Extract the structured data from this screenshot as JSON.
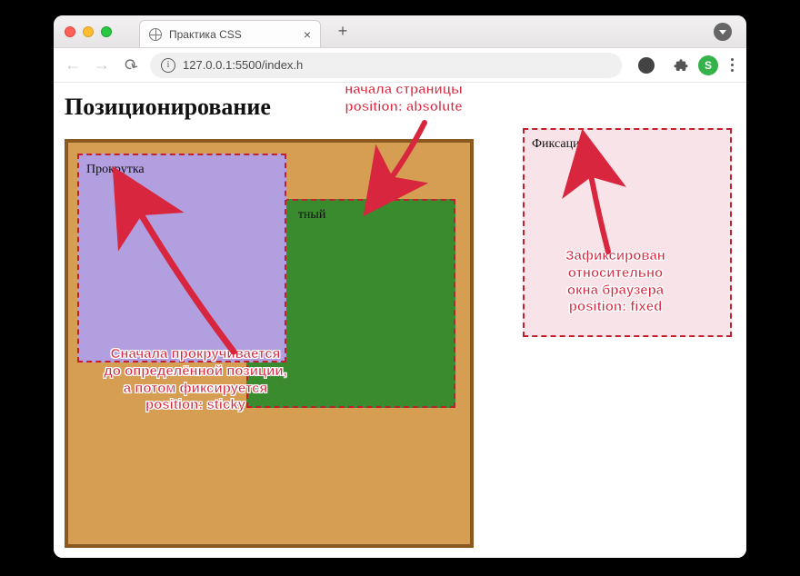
{
  "browser": {
    "tab_title": "Практика CSS",
    "url": "127.0.0.1:5500/index.h",
    "avatar_letter": "S"
  },
  "page": {
    "heading": "Позиционирование",
    "boxes": {
      "sticky_label": "Прокрутка",
      "absolute_label_suffix": "тный",
      "fixed_label": "Фиксация"
    }
  },
  "annotations": {
    "absolute": "Зафиксирован относительно\nначала страницы\nposition: absolute",
    "fixed": "Зафиксирован\nотносительно\nокна браузера\nposition: fixed",
    "sticky": "Сначала прокручивается\nдо определённой позиции,\nа потом фиксируется\nposition: sticky"
  }
}
